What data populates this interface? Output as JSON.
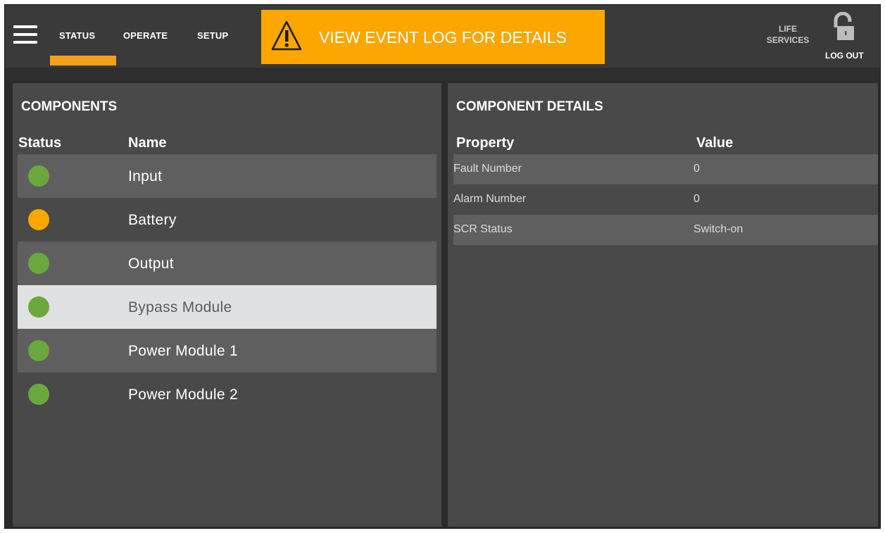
{
  "nav": {
    "tabs": [
      "STATUS",
      "OPERATE",
      "SETUP"
    ],
    "active_tab": "STATUS"
  },
  "alert": {
    "text": "VIEW EVENT LOG FOR DETAILS",
    "icon": "warning-triangle-icon",
    "color": "#fca600"
  },
  "header_right": {
    "life_services_line1": "LIFE",
    "life_services_line2": "SERVICES",
    "logout_label": "LOG OUT",
    "lock_icon": "unlocked-padlock-icon"
  },
  "components": {
    "title": "COMPONENTS",
    "col_status": "Status",
    "col_name": "Name",
    "items": [
      {
        "name": "Input",
        "status": "ok",
        "color": "#6aa83d"
      },
      {
        "name": "Battery",
        "status": "warning",
        "color": "#fca600"
      },
      {
        "name": "Output",
        "status": "ok",
        "color": "#6aa83d"
      },
      {
        "name": "Bypass Module",
        "status": "ok",
        "color": "#6aa83d",
        "selected": true
      },
      {
        "name": "Power Module 1",
        "status": "ok",
        "color": "#6aa83d"
      },
      {
        "name": "Power Module 2",
        "status": "ok",
        "color": "#6aa83d"
      }
    ]
  },
  "details": {
    "title": "COMPONENT DETAILS",
    "col_property": "Property",
    "col_value": "Value",
    "rows": [
      {
        "property": "Fault Number",
        "value": "0"
      },
      {
        "property": "Alarm Number",
        "value": "0"
      },
      {
        "property": "SCR Status",
        "value": "Switch-on"
      }
    ]
  }
}
